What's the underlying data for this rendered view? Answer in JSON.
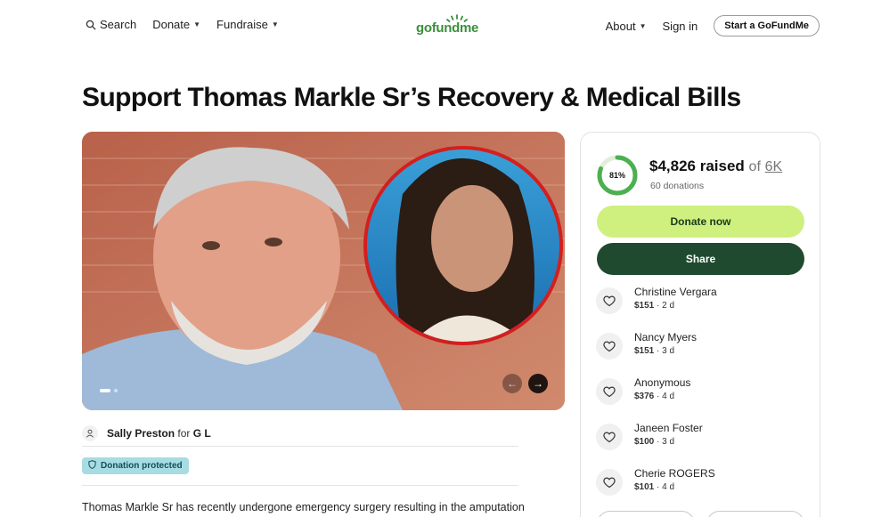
{
  "header": {
    "search_label": "Search",
    "donate_label": "Donate",
    "fundraise_label": "Fundraise",
    "logo_text": "gofundme",
    "about_label": "About",
    "signin_label": "Sign in",
    "start_label": "Start a GoFundMe"
  },
  "campaign": {
    "title": "Support Thomas Markle Sr’s Recovery & Medical Bills",
    "organizer_name": "Sally Preston",
    "organizer_for": "for",
    "beneficiary": "G L",
    "protected_label": "Donation protected",
    "story_first_line": "Thomas Markle Sr has recently undergone emergency surgery resulting in the amputation"
  },
  "funding": {
    "percent_label": "81%",
    "percent_value": 81,
    "raised": "$4,826 raised",
    "of": "of",
    "goal": "6K",
    "donation_count": "60 donations",
    "donate_button": "Donate now",
    "share_button": "Share"
  },
  "donors": [
    {
      "name": "Christine Vergara",
      "amount": "$151",
      "time": "2 d"
    },
    {
      "name": "Nancy Myers",
      "amount": "$151",
      "time": "3 d"
    },
    {
      "name": "Anonymous",
      "amount": "$376",
      "time": "4 d"
    },
    {
      "name": "Janeen Foster",
      "amount": "$100",
      "time": "3 d"
    },
    {
      "name": "Cherie ROGERS",
      "amount": "$101",
      "time": "4 d"
    }
  ],
  "colors": {
    "brand_green": "#3c8f3c",
    "donate_button": "#cff07e",
    "share_button": "#1f4a2f",
    "badge_bg": "#a8dce3"
  },
  "icons": {
    "search": "search-icon",
    "caret": "caret-down-icon",
    "person": "person-icon",
    "shield": "shield-icon",
    "heart_hand": "heart-hand-icon",
    "arrow_left": "arrow-left-icon",
    "arrow_right": "arrow-right-icon"
  }
}
